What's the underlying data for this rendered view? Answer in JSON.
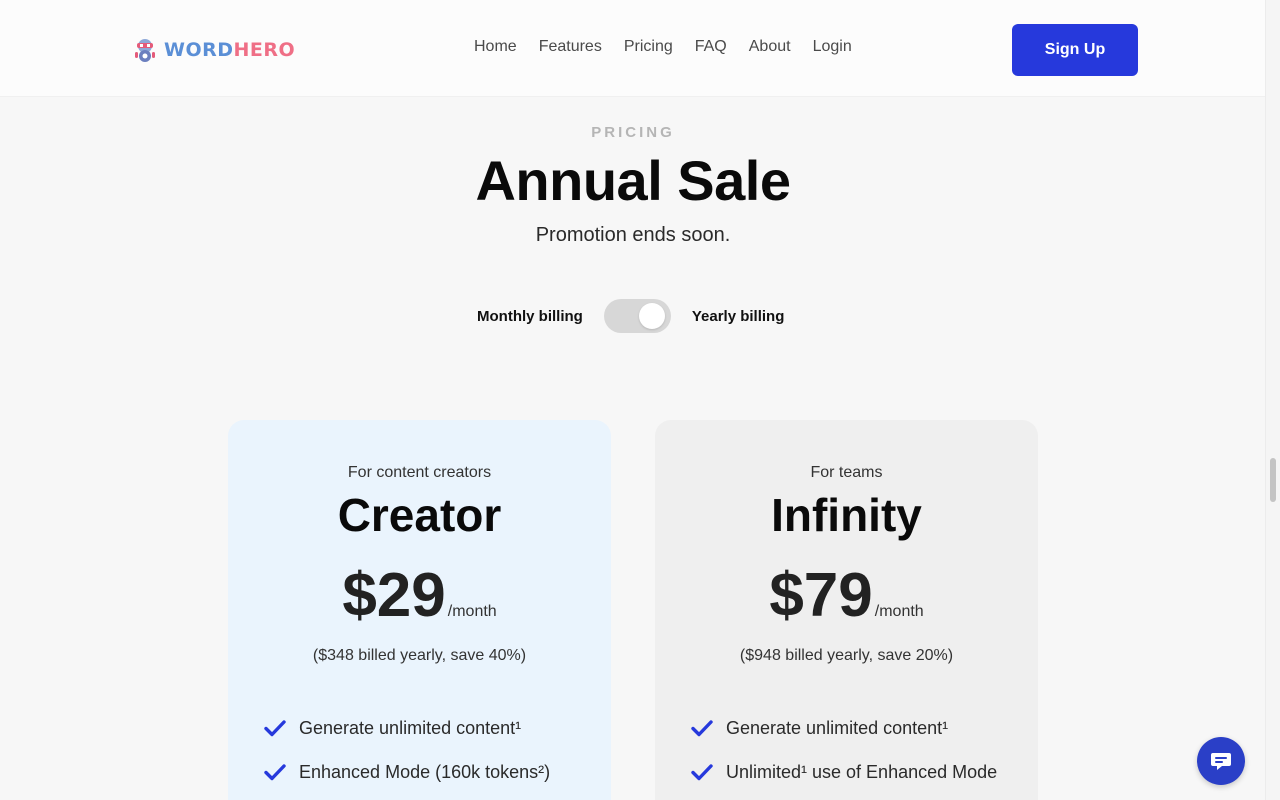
{
  "header": {
    "logo_word": "WORD",
    "logo_hero": "HERO",
    "nav": [
      "Home",
      "Features",
      "Pricing",
      "FAQ",
      "About",
      "Login"
    ],
    "signup_label": "Sign Up"
  },
  "hero": {
    "eyebrow": "PRICING",
    "title": "Annual Sale",
    "subtitle": "Promotion ends soon."
  },
  "billing": {
    "monthly_label": "Monthly billing",
    "yearly_label": "Yearly billing",
    "yearly_selected": true
  },
  "plans": [
    {
      "tagline": "For content creators",
      "name": "Creator",
      "price": "$29",
      "period": "/month",
      "billed": "($348 billed yearly, save 40%)",
      "features": [
        "Generate unlimited content¹",
        "Enhanced Mode (160k tokens²)"
      ]
    },
    {
      "tagline": "For teams",
      "name": "Infinity",
      "price": "$79",
      "period": "/month",
      "billed": "($948 billed yearly, save 20%)",
      "features": [
        "Generate unlimited content¹",
        "Unlimited¹ use of Enhanced Mode"
      ]
    }
  ],
  "colors": {
    "accent": "#2639dc",
    "creator_card": "#eaf4fd",
    "infinity_card": "#efefef",
    "logo_word": "#5b8fd6",
    "logo_hero": "#ef6f86"
  },
  "icons": {
    "check": "check-icon",
    "chat": "chat-icon",
    "logo": "robot-logo-icon"
  }
}
